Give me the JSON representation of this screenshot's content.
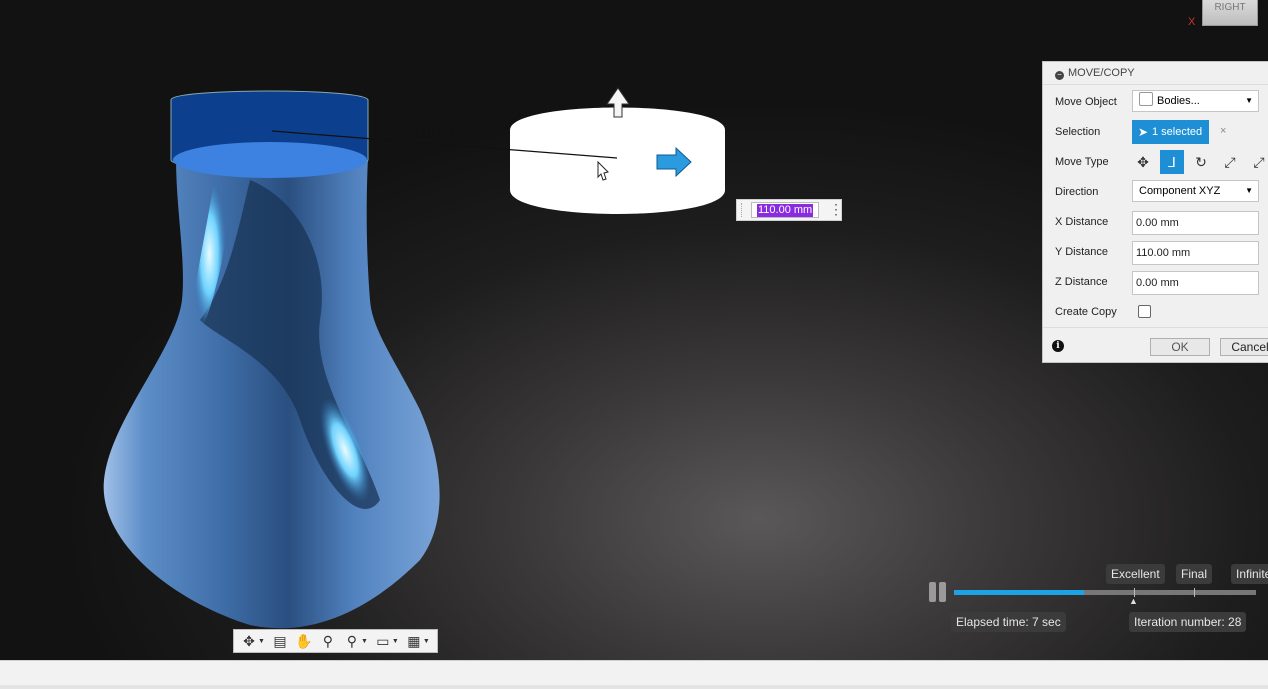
{
  "viewcube": {
    "face_label": "RIGHT",
    "axis_label": "X"
  },
  "scene": {
    "dimension_label": "110.00",
    "distance_input": "110.00 mm"
  },
  "nav_toolbar": {
    "tools": [
      {
        "icon": "orbit-icon",
        "glyph": "✥",
        "caret": true
      },
      {
        "icon": "look-at-icon",
        "glyph": "▤",
        "caret": false
      },
      {
        "icon": "pan-hand-icon",
        "glyph": "✋",
        "caret": false
      },
      {
        "icon": "zoom-icon",
        "glyph": "⚲",
        "caret": false
      },
      {
        "icon": "zoom-window-icon",
        "glyph": "⚲",
        "caret": true
      },
      {
        "icon": "display-settings-icon",
        "glyph": "▭",
        "caret": true
      },
      {
        "icon": "grid-icon",
        "glyph": "▦",
        "caret": true
      }
    ]
  },
  "dialog": {
    "title": "MOVE/COPY",
    "move_object": {
      "label": "Move Object",
      "value": "Bodies..."
    },
    "selection": {
      "label": "Selection",
      "value": "1 selected",
      "clear": "×"
    },
    "move_type": {
      "label": "Move Type",
      "icons": [
        "free-move-icon",
        "translate-xyz-icon",
        "rotate-icon",
        "point-to-point-icon",
        "point-to-position-icon"
      ],
      "active_index": 1
    },
    "direction": {
      "label": "Direction",
      "value": "Component XYZ"
    },
    "x_distance": {
      "label": "X Distance",
      "value": "0.00 mm"
    },
    "y_distance": {
      "label": "Y Distance",
      "value": "110.00 mm"
    },
    "z_distance": {
      "label": "Z Distance",
      "value": "0.00 mm"
    },
    "create_copy": {
      "label": "Create Copy",
      "checked": false
    },
    "ok_label": "OK",
    "cancel_label": "Cancel"
  },
  "render": {
    "markers": [
      "Excellent",
      "Final",
      "Infinite"
    ],
    "progress": 0.43,
    "elapsed": "Elapsed time: 7 sec",
    "iteration": "Iteration number: 28"
  },
  "colors": {
    "accent": "#1e8fd5",
    "progress_fill": "#1ea2e6",
    "vase": "#5b8fcf",
    "selected_cap": "#0d3f8f"
  }
}
